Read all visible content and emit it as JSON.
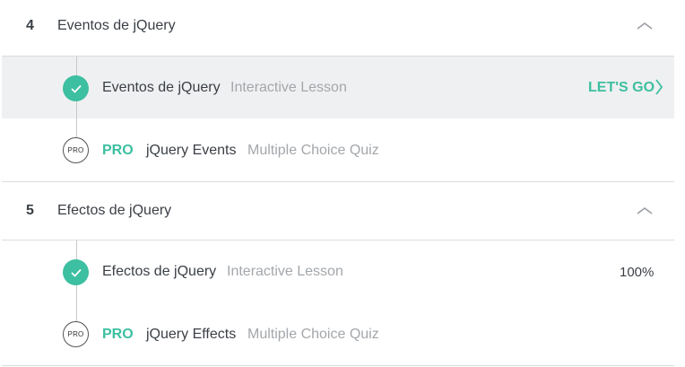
{
  "sections": [
    {
      "number": "4",
      "title": "Eventos de jQuery",
      "lessons": [
        {
          "title": "Eventos de jQuery",
          "type": "Interactive Lesson",
          "status": "completed",
          "action": "LET'S GO"
        },
        {
          "pro_badge": "PRO",
          "pro_label": "PRO",
          "title": "jQuery Events",
          "type": "Multiple Choice Quiz",
          "status": "locked"
        }
      ]
    },
    {
      "number": "5",
      "title": "Efectos de jQuery",
      "lessons": [
        {
          "title": "Efectos de jQuery",
          "type": "Interactive Lesson",
          "status": "completed",
          "progress": "100%"
        },
        {
          "pro_badge": "PRO",
          "pro_label": "PRO",
          "title": "jQuery Effects",
          "type": "Multiple Choice Quiz",
          "status": "locked"
        }
      ]
    }
  ],
  "colors": {
    "accent": "#3dbfa1",
    "highlight_row": "#eff0f1",
    "divider": "#dcdcdc",
    "muted_text": "#a3a7ab"
  },
  "icons": {
    "completed": "check-circle-icon",
    "collapse": "chevron-up-icon",
    "go": "chevron-right-icon",
    "pro": "pro-badge-icon"
  }
}
